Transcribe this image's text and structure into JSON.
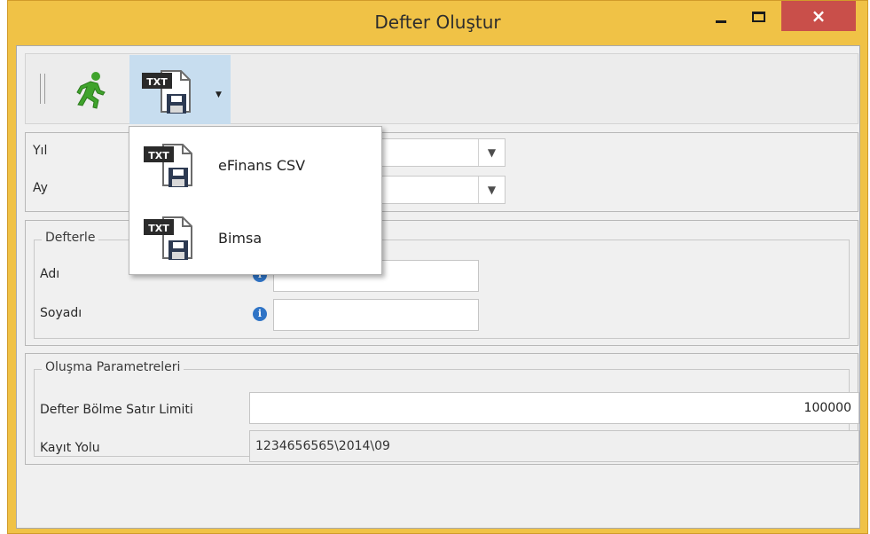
{
  "window": {
    "title": "Defter Oluştur",
    "minimize_icon": "minimize-icon",
    "maximize_icon": "maximize-icon",
    "close_glyph": "×",
    "close_color": "#c94f4a"
  },
  "toolbar": {
    "run_icon": "running-man-icon",
    "export_icon": "txt-save-file-icon",
    "export_dropdown_icon": "dropdown-arrow-icon",
    "active_bg": "#c7ddef"
  },
  "dropdown_menu": {
    "items": [
      {
        "label": "eFinans CSV",
        "icon": "txt-save-file-icon"
      },
      {
        "label": "Bimsa",
        "icon": "txt-save-file-icon"
      }
    ]
  },
  "period": {
    "year_label": "Yıl",
    "month_label": "Ay",
    "year_value": "",
    "month_value": ""
  },
  "ledger_owner": {
    "legend": "Defterle",
    "first_name_label": "Adı",
    "last_name_label": "Soyadı",
    "first_name_value": "",
    "last_name_value": "",
    "info_icon": "info-icon"
  },
  "creation_params": {
    "legend": "Oluşma Parametreleri",
    "split_limit_label": "Defter Bölme Satır Limiti",
    "split_limit_value": "100000",
    "save_path_label": "Kayıt Yolu",
    "save_path_value": "1234656565\\2014\\09"
  },
  "colors": {
    "window_frame": "#f0c246",
    "client_bg": "#f0f0f0",
    "info_blue": "#2f74c6"
  }
}
